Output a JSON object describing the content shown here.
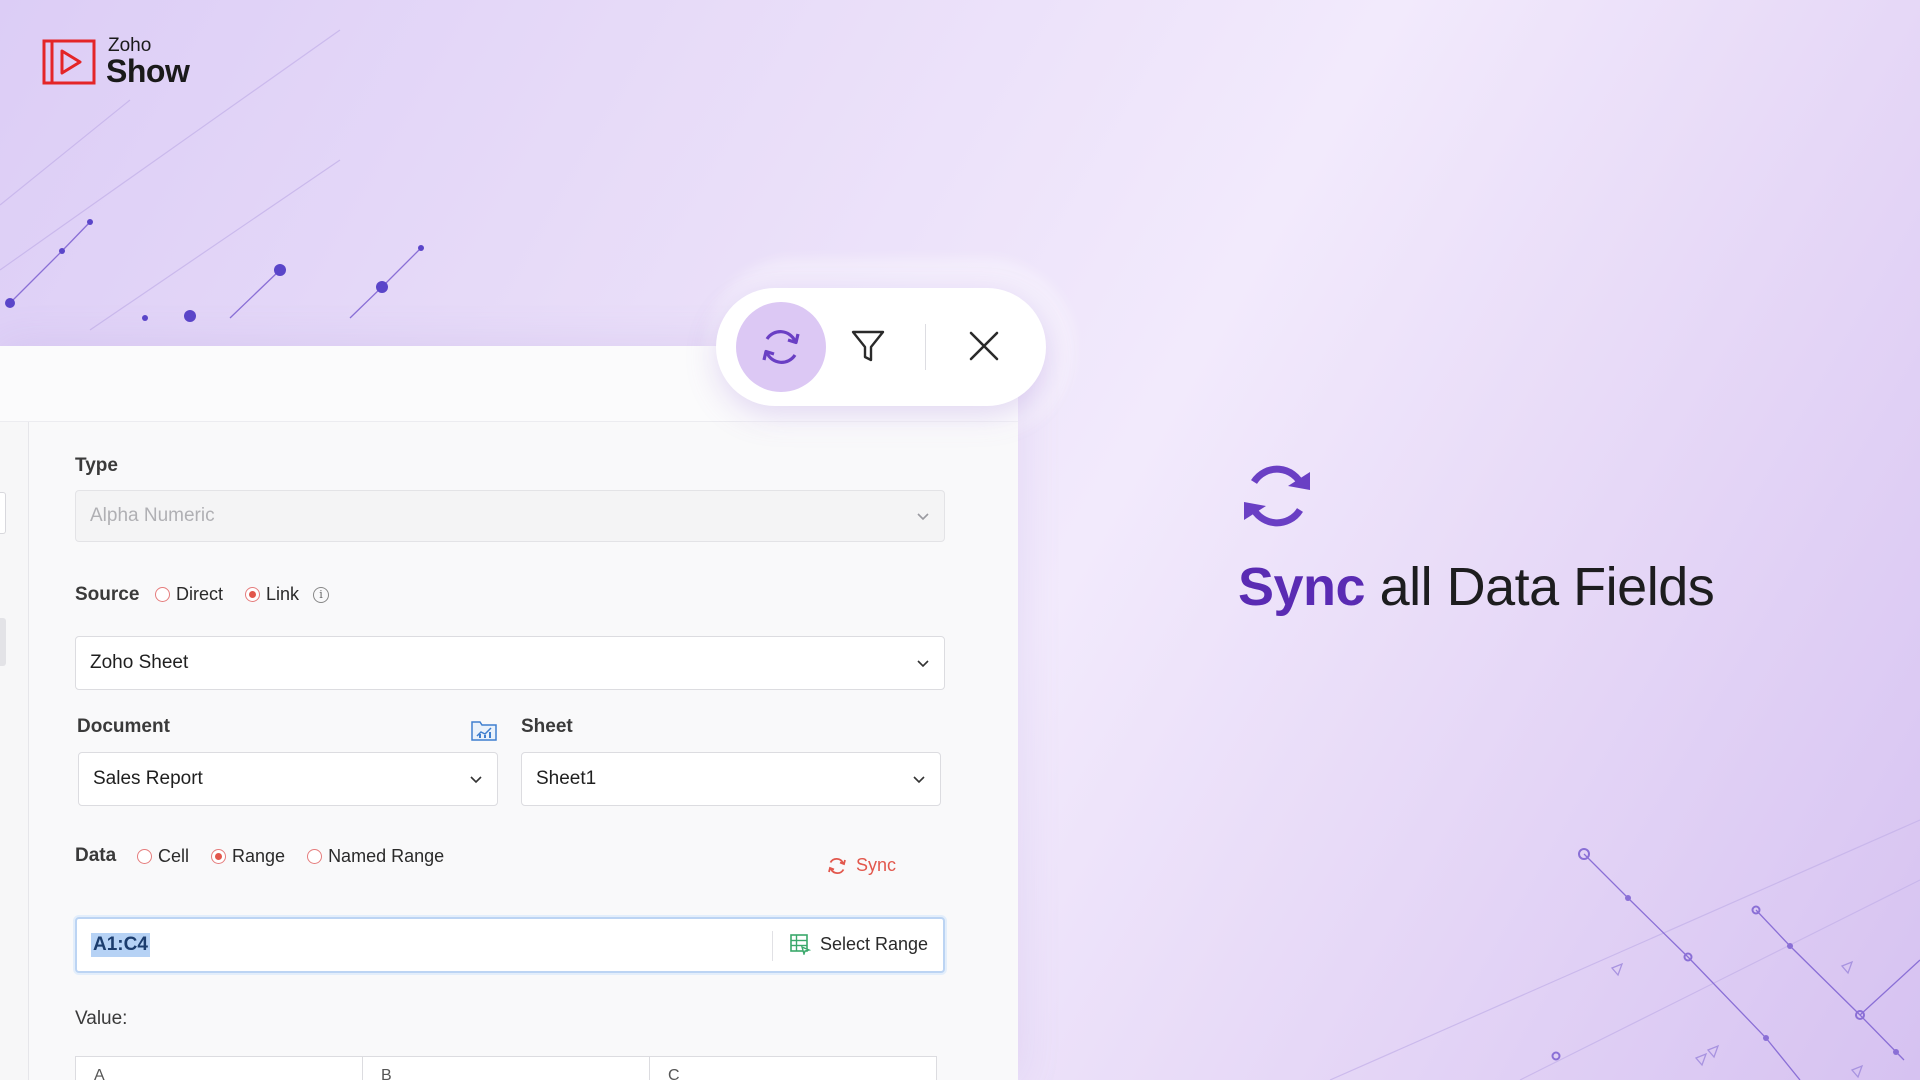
{
  "brand": {
    "small": "Zoho",
    "big": "Show",
    "color": "#e42527"
  },
  "toolbar": {
    "sync_icon": "sync-icon",
    "filter_icon": "filter-icon",
    "close_icon": "close-icon"
  },
  "form": {
    "type_label": "Type",
    "type_value": "Alpha Numeric",
    "source_label": "Source",
    "source_options": [
      "Direct",
      "Link"
    ],
    "source_selected": "Link",
    "source_app": "Zoho Sheet",
    "document_label": "Document",
    "document_value": "Sales Report",
    "sheet_label": "Sheet",
    "sheet_value": "Sheet1",
    "data_label": "Data",
    "data_options": [
      "Cell",
      "Range",
      "Named Range"
    ],
    "data_selected": "Range",
    "sync_label": "Sync",
    "range_value": "A1:C4",
    "select_range_label": "Select Range",
    "value_label": "Value:",
    "value_columns": [
      "A",
      "B",
      "C"
    ]
  },
  "headline": {
    "accent": "Sync",
    "rest": " all Data Fields"
  },
  "colors": {
    "accent_purple": "#5a2bb3",
    "radio_red": "#e2574c",
    "toolbar_sync_bg": "#dcc8f4"
  }
}
